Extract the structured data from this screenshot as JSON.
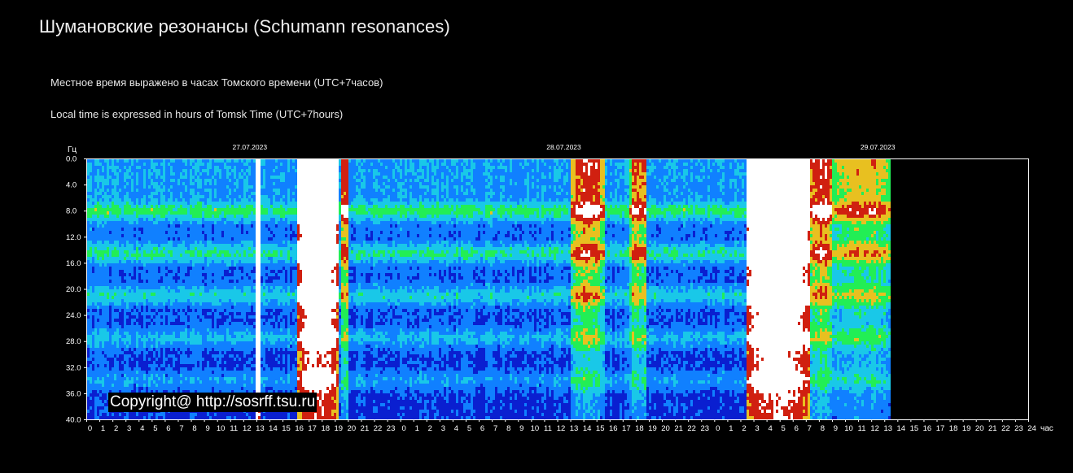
{
  "header": {
    "title": "Шумановские резонансы (Schumann resonances)",
    "subtitle_ru": "Местное время выражено в часах Томского времени (UTC+7часов)",
    "subtitle_en": "Local time is expressed in hours of Tomsk Time (UTC+7hours)"
  },
  "watermark": "Copyright@ http://sosrff.tsu.ru",
  "chart_data": {
    "type": "heatmap",
    "ylabel": "Гц",
    "xlabel": "час",
    "y_ticks": [
      "0.0",
      "4.0",
      "8.0",
      "12.0",
      "16.0",
      "20.0",
      "24.0",
      "28.0",
      "32.0",
      "36.0",
      "40.0"
    ],
    "ylim": [
      0,
      40
    ],
    "y_direction": "top-to-bottom",
    "x_hours_total": 72,
    "x_tick_labels": [
      "0",
      "1",
      "2",
      "3",
      "4",
      "5",
      "6",
      "7",
      "8",
      "9",
      "10",
      "11",
      "12",
      "13",
      "14",
      "15",
      "16",
      "17",
      "18",
      "19",
      "20",
      "21",
      "22",
      "23",
      "0",
      "1",
      "2",
      "3",
      "4",
      "5",
      "6",
      "7",
      "8",
      "9",
      "10",
      "11",
      "12",
      "13",
      "14",
      "15",
      "16",
      "17",
      "18",
      "19",
      "20",
      "21",
      "22",
      "23",
      "0",
      "1",
      "2",
      "3",
      "4",
      "5",
      "6",
      "7",
      "8",
      "9",
      "10",
      "11",
      "12",
      "13",
      "14",
      "15",
      "16",
      "17",
      "18",
      "19",
      "20",
      "21",
      "22",
      "23",
      "24"
    ],
    "dates": [
      {
        "label": "27.07.2023",
        "hour": 12
      },
      {
        "label": "28.07.2023",
        "hour": 36
      },
      {
        "label": "29.07.2023",
        "hour": 60
      }
    ],
    "data_end_hour": 61.3,
    "resonance_bands_hz": [
      7.8,
      14.3,
      20.8,
      27.3,
      33.8
    ],
    "colors": {
      "background": "#000000",
      "low": "#0a1fd0",
      "mid_low": "#1080ff",
      "mid": "#19c8e8",
      "high": "#22ee55",
      "higher": "#e8c020",
      "peak": "#d02010",
      "saturated": "#ffffff"
    },
    "events": [
      {
        "start_hour": 12.8,
        "end_hour": 13.3,
        "intensity": 1.0
      },
      {
        "start_hour": 16.0,
        "end_hour": 19.2,
        "intensity": 0.95
      },
      {
        "start_hour": 19.3,
        "end_hour": 20.0,
        "intensity": 0.55
      },
      {
        "start_hour": 37.0,
        "end_hour": 39.5,
        "intensity": 0.55
      },
      {
        "start_hour": 41.5,
        "end_hour": 42.8,
        "intensity": 0.5
      },
      {
        "start_hour": 50.3,
        "end_hour": 55.2,
        "intensity": 1.0
      },
      {
        "start_hour": 55.2,
        "end_hour": 57.0,
        "intensity": 0.6
      },
      {
        "start_hour": 57.0,
        "end_hour": 61.3,
        "intensity": 0.4
      }
    ]
  }
}
